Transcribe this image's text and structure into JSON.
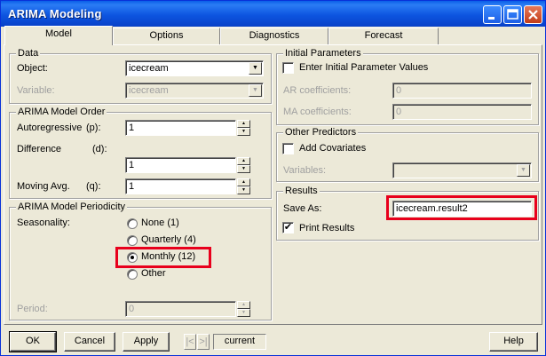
{
  "window": {
    "title": "ARIMA Modeling",
    "controls": [
      "minimize-icon",
      "maximize-icon",
      "close-icon"
    ]
  },
  "tabs": [
    {
      "label": "Model",
      "active": true
    },
    {
      "label": "Options",
      "active": false
    },
    {
      "label": "Diagnostics",
      "active": false
    },
    {
      "label": "Forecast",
      "active": false
    }
  ],
  "data_group": {
    "label": "Data",
    "object_label": "Object:",
    "object_value": "icecream",
    "variable_label": "Variable:",
    "variable_value": "icecream"
  },
  "order_group": {
    "label": "ARIMA Model Order",
    "ar_label": "Autoregressive",
    "ar_sym": "(p):",
    "ar_value": "1",
    "diff_label": "Difference",
    "diff_sym": "(d):",
    "diff_value": "1",
    "ma_label": "Moving Avg.",
    "ma_sym": "(q):",
    "ma_value": "1"
  },
  "periodicity_group": {
    "label": "ARIMA Model Periodicity",
    "seasonality_label": "Seasonality:",
    "options": [
      {
        "label": "None (1)",
        "selected": false
      },
      {
        "label": "Quarterly (4)",
        "selected": false
      },
      {
        "label": "Monthly (12)",
        "selected": true
      },
      {
        "label": "Other",
        "selected": false
      }
    ],
    "period_label": "Period:",
    "period_value": "0"
  },
  "initial_group": {
    "label": "Initial Parameters",
    "checkbox_label": "Enter Initial Parameter Values",
    "checked": false,
    "ar_coef_label": "AR coefficients:",
    "ar_coef_value": "0",
    "ma_coef_label": "MA coefficients:",
    "ma_coef_value": "0"
  },
  "predictors_group": {
    "label": "Other Predictors",
    "checkbox_label": "Add Covariates",
    "checked": false,
    "variables_label": "Variables:",
    "variables_value": ""
  },
  "results_group": {
    "label": "Results",
    "save_as_label": "Save As:",
    "save_as_value": "icecream.result2",
    "print_label": "Print Results",
    "print_checked": true,
    "check_mark": "✔"
  },
  "footer": {
    "ok": "OK",
    "cancel": "Cancel",
    "apply": "Apply",
    "current": "current",
    "help": "Help"
  },
  "highlight_color": "#e8001c"
}
